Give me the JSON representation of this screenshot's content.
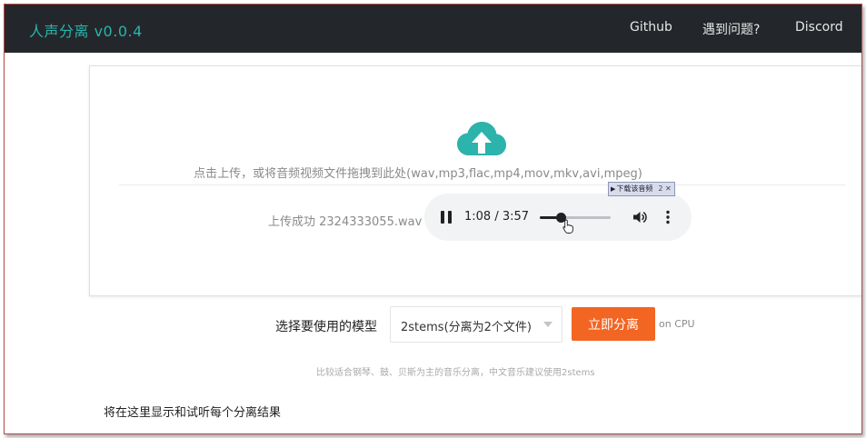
{
  "navbar": {
    "brand": "人声分离 v0.0.4",
    "links": [
      {
        "label": "Github"
      },
      {
        "label": "遇到问题?"
      },
      {
        "label": "Discord"
      }
    ]
  },
  "upload": {
    "icon": "cloud-upload-icon",
    "hint": "点击上传，或将音频视频文件拖拽到此处(wav,mp3,flac,mp4,mov,mkv,avi,mpeg)",
    "status": "上传成功 2324333055.wav"
  },
  "player": {
    "time": "1:08 / 3:57",
    "progress": 0.29,
    "pause_icon": "pause-icon",
    "volume_icon": "volume-icon",
    "more_icon": "more-vert-icon"
  },
  "download_overlay": {
    "label": "下载该音频",
    "extra": "2 ✕"
  },
  "model": {
    "label": "选择要使用的模型",
    "selected": "2stems(分离为2个文件)",
    "button": "立即分离",
    "device_note": "on CPU",
    "description": "比较适合钢琴、鼓、贝斯为主的音乐分离，中文音乐建议使用2stems"
  },
  "results": {
    "heading": "将在这里显示和试听每个分离结果"
  },
  "colors": {
    "navbar_bg": "#23272b",
    "brand": "#2bb3ac",
    "accent_button": "#f26522",
    "cloud_icon": "#2bb3ac"
  }
}
